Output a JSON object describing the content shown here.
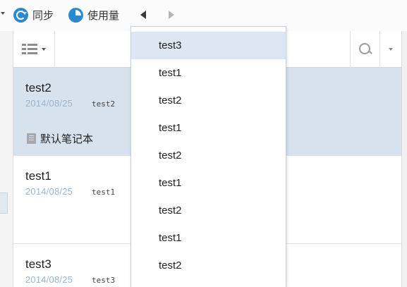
{
  "toolbar": {
    "sync_label": "同步",
    "usage_label": "使用量",
    "sync_icon": "sync-icon",
    "usage_icon": "pie-chart-icon"
  },
  "notes": [
    {
      "title": "test2",
      "date": "2014/08/25",
      "snippet": "test2",
      "notebook": "默认笔记本",
      "selected": true
    },
    {
      "title": "test1",
      "date": "2014/08/25",
      "snippet": "test1",
      "selected": false
    },
    {
      "title": "test3",
      "date": "2014/08/25",
      "snippet": "test3",
      "selected": false
    }
  ],
  "dropdown": {
    "items": [
      "test3",
      "test1",
      "test2",
      "test1",
      "test2",
      "test1",
      "test2",
      "test1",
      "test2"
    ],
    "active_index": 0
  },
  "colors": {
    "accent": "#2a89d0",
    "selected_row": "#d6e2ee",
    "dropdown_active": "#dde7f3",
    "date_text": "#9cb5cc"
  }
}
